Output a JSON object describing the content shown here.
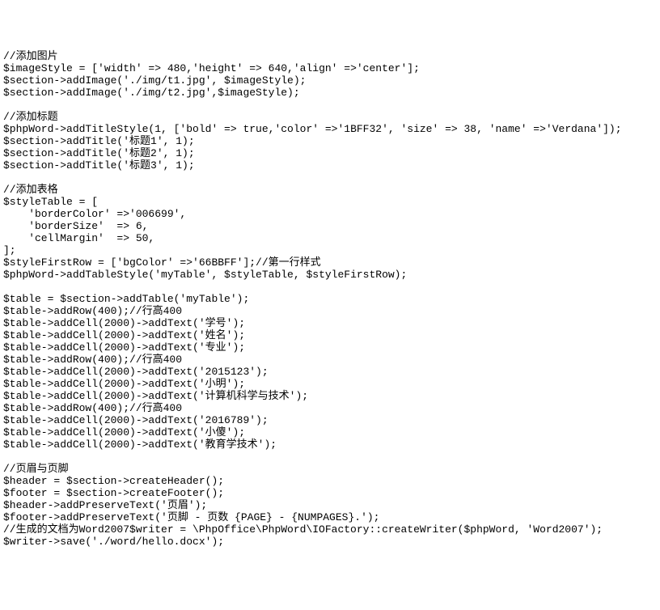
{
  "lines": [
    "//添加图片",
    "$imageStyle = ['width' => 480,'height' => 640,'align' =>'center'];",
    "$section->addImage('./img/t1.jpg', $imageStyle);",
    "$section->addImage('./img/t2.jpg',$imageStyle);",
    "",
    "//添加标题",
    "$phpWord->addTitleStyle(1, ['bold' => true,'color' =>'1BFF32', 'size' => 38, 'name' =>'Verdana']);",
    "$section->addTitle('标题1', 1);",
    "$section->addTitle('标题2', 1);",
    "$section->addTitle('标题3', 1);",
    "",
    "//添加表格",
    "$styleTable = [",
    "    'borderColor' =>'006699',",
    "    'borderSize'  => 6,",
    "    'cellMargin'  => 50,",
    "];",
    "$styleFirstRow = ['bgColor' =>'66BBFF'];//第一行样式",
    "$phpWord->addTableStyle('myTable', $styleTable, $styleFirstRow);",
    "",
    "$table = $section->addTable('myTable');",
    "$table->addRow(400);//行高400",
    "$table->addCell(2000)->addText('学号');",
    "$table->addCell(2000)->addText('姓名');",
    "$table->addCell(2000)->addText('专业');",
    "$table->addRow(400);//行高400",
    "$table->addCell(2000)->addText('2015123');",
    "$table->addCell(2000)->addText('小明');",
    "$table->addCell(2000)->addText('计算机科学与技术');",
    "$table->addRow(400);//行高400",
    "$table->addCell(2000)->addText('2016789');",
    "$table->addCell(2000)->addText('小傻');",
    "$table->addCell(2000)->addText('教育学技术');",
    "",
    "//页眉与页脚",
    "$header = $section->createHeader();",
    "$footer = $section->createFooter();",
    "$header->addPreserveText('页眉');",
    "$footer->addPreserveText('页脚 - 页数 {PAGE} - {NUMPAGES}.');",
    "//生成的文档为Word2007$writer = \\PhpOffice\\PhpWord\\IOFactory::createWriter($phpWord, 'Word2007');",
    "$writer->save('./word/hello.docx');"
  ]
}
